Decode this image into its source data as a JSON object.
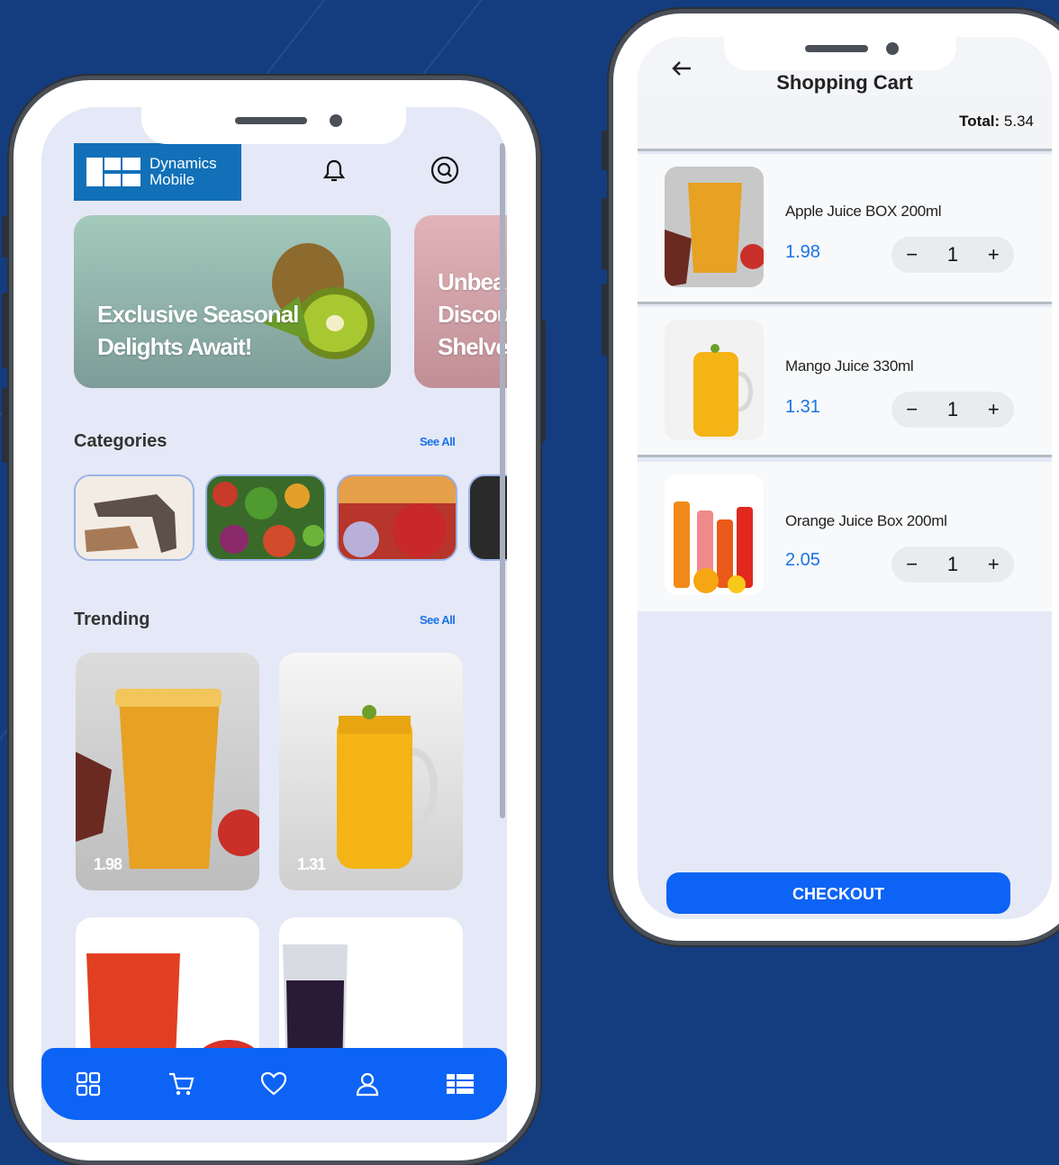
{
  "home": {
    "logo": {
      "line1": "Dynamics",
      "line2": "Mobile"
    },
    "icons": {
      "notification": "bell-icon",
      "search": "search-icon"
    },
    "banners": [
      {
        "line1": "Exclusive Seasonal",
        "line2": "Delights Await!",
        "line3": "",
        "color": "#9cc1b5"
      },
      {
        "line1": "Unbea",
        "line2": "Discou",
        "line3": "Shelve",
        "color": "#d8a3ab"
      }
    ],
    "categories": {
      "title": "Categories",
      "see_all": "See All"
    },
    "trending": {
      "title": "Trending",
      "see_all": "See All"
    },
    "products": [
      {
        "price": "1.98"
      },
      {
        "price": "1.31"
      },
      {
        "price": ""
      },
      {
        "price": ""
      }
    ],
    "bottom_nav": [
      "grid-icon",
      "cart-icon",
      "heart-icon",
      "user-icon",
      "menu-icon"
    ]
  },
  "cart": {
    "title": "Shopping Cart",
    "total_label": "Total:",
    "total_value": "5.34",
    "items": [
      {
        "name": "Apple Juice BOX 200ml",
        "price": "1.98",
        "qty": "1",
        "minus": "−",
        "plus": "+"
      },
      {
        "name": "Mango Juice 330ml",
        "price": "1.31",
        "qty": "1",
        "minus": "−",
        "plus": "+"
      },
      {
        "name": "Orange Juice Box 200ml",
        "price": "2.05",
        "qty": "1",
        "minus": "−",
        "plus": "+"
      }
    ],
    "checkout_label": "CHECKOUT"
  },
  "colors": {
    "background": "#143d7f",
    "accent": "#0d63f5",
    "price": "#1a73e8",
    "logo": "#1170b8"
  }
}
